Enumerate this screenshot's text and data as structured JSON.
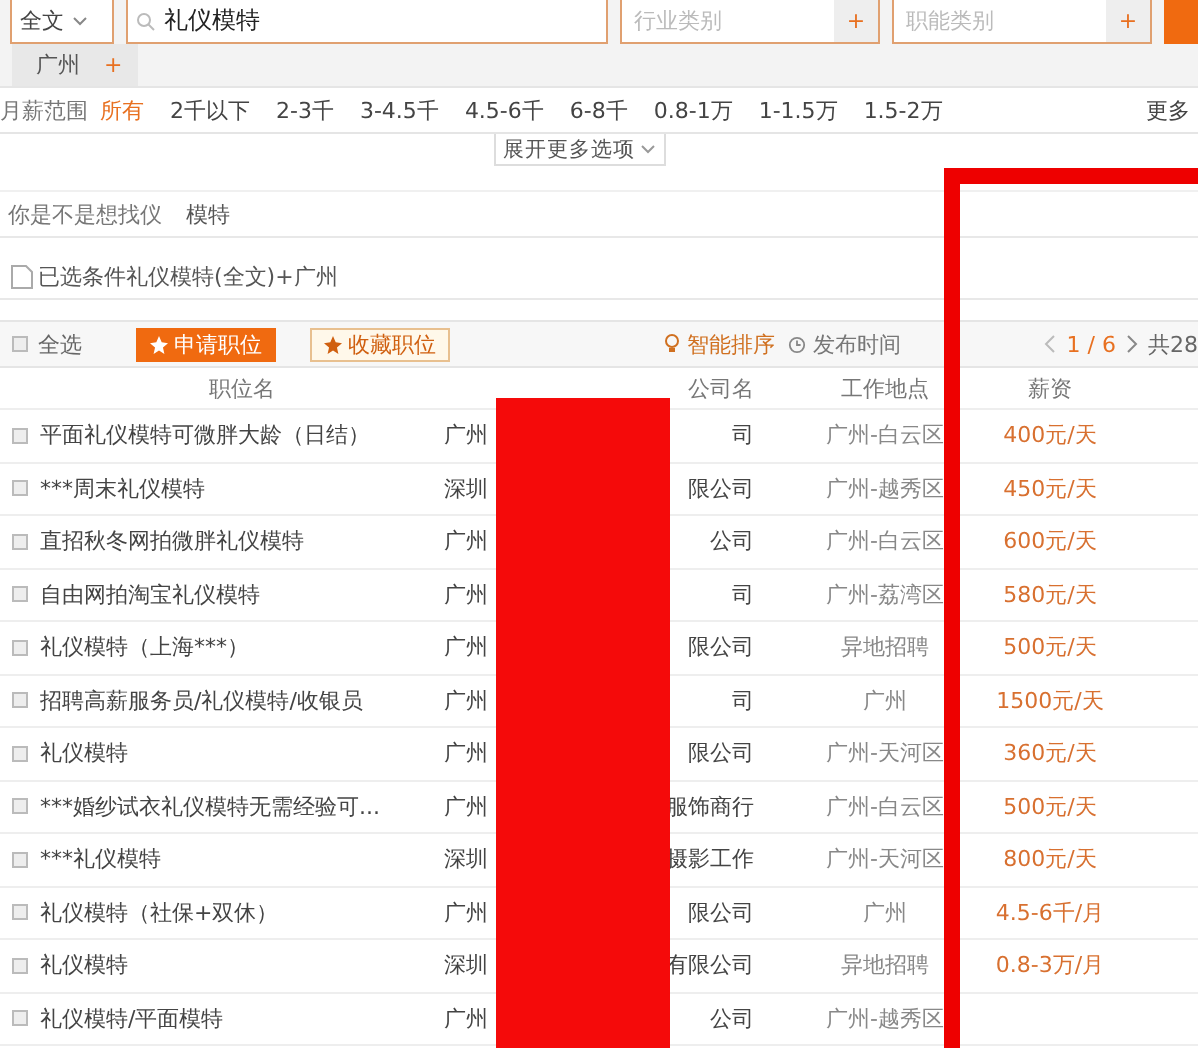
{
  "search": {
    "scope": "全文",
    "query": "礼仪模特",
    "industry_placeholder": "行业类别",
    "function_placeholder": "职能类别",
    "add_icon": "+",
    "city": "广州",
    "city_add": "+"
  },
  "salary_filter": {
    "label": "月薪范围",
    "options": [
      {
        "label": "所有",
        "selected": true
      },
      {
        "label": "2千以下",
        "selected": false
      },
      {
        "label": "2-3千",
        "selected": false
      },
      {
        "label": "3-4.5千",
        "selected": false
      },
      {
        "label": "4.5-6千",
        "selected": false
      },
      {
        "label": "6-8千",
        "selected": false
      },
      {
        "label": "0.8-1万",
        "selected": false
      },
      {
        "label": "1-1.5万",
        "selected": false
      },
      {
        "label": "1.5-2万",
        "selected": false
      }
    ],
    "more": "更多"
  },
  "expand": "展开更多选项",
  "suggestion": {
    "label": "你是不是想找仪",
    "term": "模特"
  },
  "selected_conditions": "已选条件礼仪模特(全文)+广州",
  "toolbar": {
    "select_all_checked": false,
    "select_all": "全选",
    "apply": "申请职位",
    "favorite": "收藏职位",
    "smart_sort": "智能排序",
    "publish_time": "发布时间",
    "page": "1 / 6",
    "total": "共28"
  },
  "table": {
    "columns": [
      "职位名",
      "公司名",
      "工作地点",
      "薪资"
    ],
    "rows": [
      {
        "checked": false,
        "title": "平面礼仪模特可微胖大龄（日结）",
        "company_start": "广州",
        "company_end": "司",
        "location": "广州-白云区",
        "salary": "400元/天"
      },
      {
        "checked": false,
        "title": "***周末礼仪模特",
        "company_start": "深圳",
        "company_end": "限公司",
        "location": "广州-越秀区",
        "salary": "450元/天"
      },
      {
        "checked": false,
        "title": "直招秋冬网拍微胖礼仪模特",
        "company_start": "广州",
        "company_end": "公司",
        "location": "广州-白云区",
        "salary": "600元/天"
      },
      {
        "checked": false,
        "title": "自由网拍淘宝礼仪模特",
        "company_start": "广州",
        "company_end": "司",
        "location": "广州-荔湾区",
        "salary": "580元/天"
      },
      {
        "checked": false,
        "title": "礼仪模特（上海***）",
        "company_start": "广州",
        "company_end": "限公司",
        "location": "异地招聘",
        "salary": "500元/天"
      },
      {
        "checked": false,
        "title": "招聘高薪服务员/礼仪模特/收银员",
        "company_start": "广州",
        "company_end": "司",
        "location": "广州",
        "salary": "1500元/天"
      },
      {
        "checked": false,
        "title": "礼仪模特",
        "company_start": "广州",
        "company_end": "限公司",
        "location": "广州-天河区",
        "salary": "360元/天"
      },
      {
        "checked": false,
        "title": "***婚纱试衣礼仪模特无需经验可...",
        "company_start": "广州",
        "company_end": "服饰商行",
        "location": "广州-白云区",
        "salary": "500元/天"
      },
      {
        "checked": false,
        "title": "***礼仪模特",
        "company_start": "深圳",
        "company_end": "摄影工作",
        "location": "广州-天河区",
        "salary": "800元/天"
      },
      {
        "checked": false,
        "title": "礼仪模特（社保+双休）",
        "company_start": "广州",
        "company_end": "限公司",
        "location": "广州",
        "salary": "4.5-6千/月"
      },
      {
        "checked": false,
        "title": "礼仪模特",
        "company_start": "深圳",
        "company_end": "有限公司",
        "location": "异地招聘",
        "salary": "0.8-3万/月"
      },
      {
        "checked": false,
        "title": "礼仪模特/平面模特",
        "company_start": "广州",
        "company_end": "公司",
        "location": "广州-越秀区",
        "salary": ""
      }
    ]
  }
}
